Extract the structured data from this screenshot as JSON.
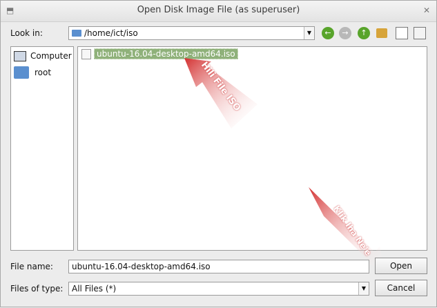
{
  "window": {
    "title": "Open Disk Image File (as superuser)",
    "restore_glyph": "⬒",
    "close_glyph": "✕"
  },
  "look_in": {
    "label": "Look in:",
    "path": "/home/ict/iso"
  },
  "toolbar": {
    "back_icon": "arrow-left-icon",
    "forward_icon": "arrow-right-icon",
    "up_icon": "arrow-up-icon",
    "new_folder_icon": "new-folder-icon",
    "view_icon": "detail-view-icon"
  },
  "sidebar": {
    "items": [
      {
        "label": "Computer",
        "icon": "computer-icon"
      },
      {
        "label": "root",
        "icon": "folder-icon"
      }
    ]
  },
  "files": {
    "items": [
      {
        "name": "ubuntu-16.04-desktop-amd64.iso",
        "selected": true
      }
    ]
  },
  "annotations": {
    "first": "Hili File ISO",
    "second": "Klik Iha Ne'e"
  },
  "file_name": {
    "label": "File name:",
    "value": "ubuntu-16.04-desktop-amd64.iso"
  },
  "file_type": {
    "label": "Files of type:",
    "value": "All Files (*)"
  },
  "buttons": {
    "open": "Open",
    "cancel": "Cancel"
  },
  "colors": {
    "selection": "#8fb17a",
    "annotation_red": "#d32f2f"
  }
}
